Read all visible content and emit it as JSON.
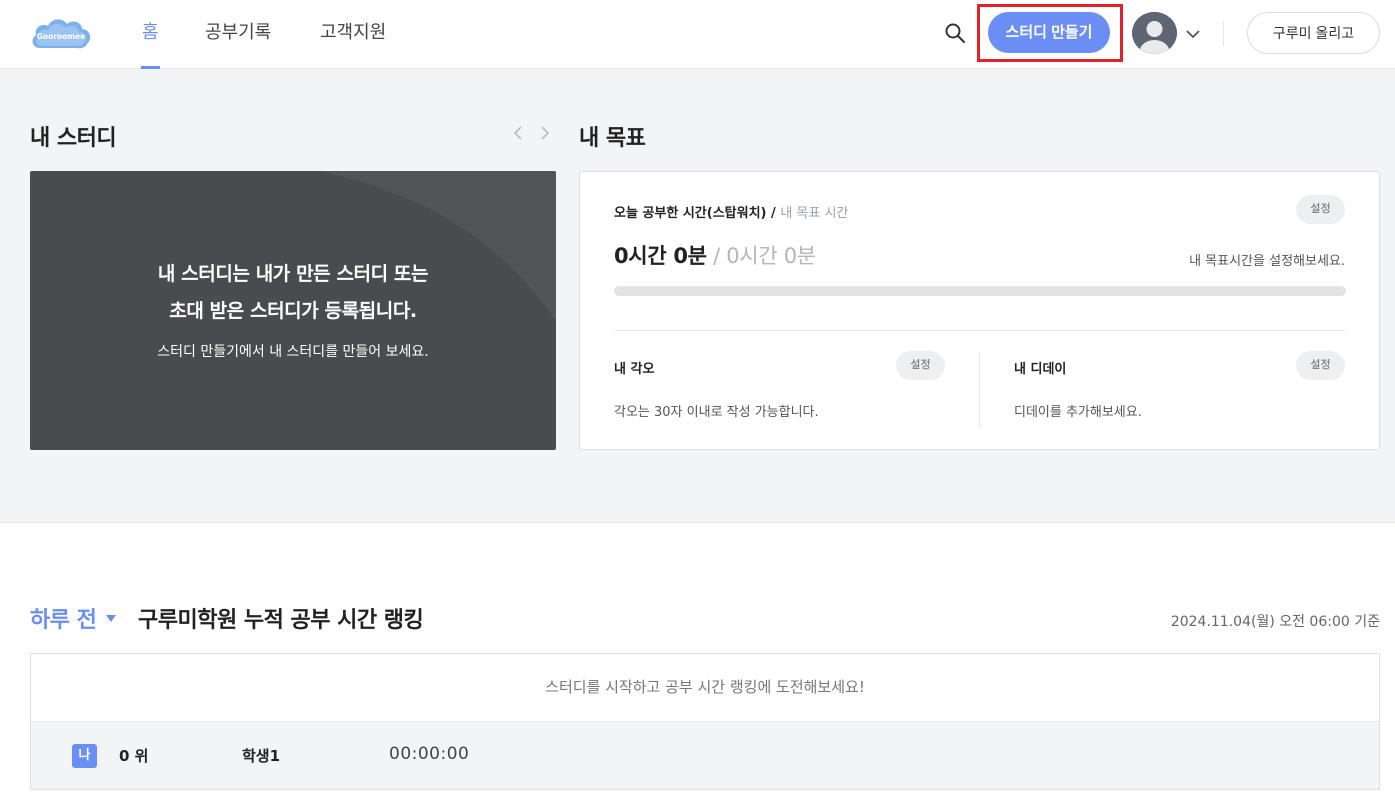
{
  "header": {
    "logo_text": "Gooroomee",
    "nav": [
      {
        "label": "홈",
        "active": true
      },
      {
        "label": "공부기록",
        "active": false
      },
      {
        "label": "고객지원",
        "active": false
      }
    ],
    "search_icon": "search-icon",
    "create_study_label": "스터디 만들기",
    "upload_label": "구루미 올리고"
  },
  "my_study": {
    "title": "내 스터디",
    "card_line1": "내 스터디는 내가 만든 스터디 또는",
    "card_line2": "초대 받은 스터디가 등록됩니다.",
    "card_sub": "스터디 만들기에서 내 스터디를 만들어 보세요."
  },
  "my_goal": {
    "title": "내 목표",
    "label_main": "오늘 공부한 시간(스탑워치)",
    "label_sep": " / ",
    "label_muted": "내 목표 시간",
    "setting_label": "설정",
    "time_studied": "0시간 0분",
    "time_sep": " / ",
    "time_goal": "0시간 0분",
    "hint": "내 목표시간을 설정해보세요.",
    "progress": 0,
    "resolve": {
      "title": "내 각오",
      "setting_label": "설정",
      "desc": "각오는 30자 이내로 작성 가능합니다."
    },
    "dday": {
      "title": "내 디데이",
      "setting_label": "설정",
      "desc": "디데이를 추가해보세요."
    }
  },
  "ranking": {
    "period": "하루 전",
    "title": "구루미학원 누적 공부 시간 랭킹",
    "date": "2024.11.04(월) 오전 06:00 기준",
    "message": "스터디를 시작하고 공부 시간 랭킹에 도전해보세요!",
    "me_badge": "나",
    "rank": "0 위",
    "name": "학생1",
    "time": "00:00:00"
  },
  "colors": {
    "accent": "#6a8ef4",
    "highlight": "#e1222a",
    "card_dark": "#4a4b4e"
  }
}
